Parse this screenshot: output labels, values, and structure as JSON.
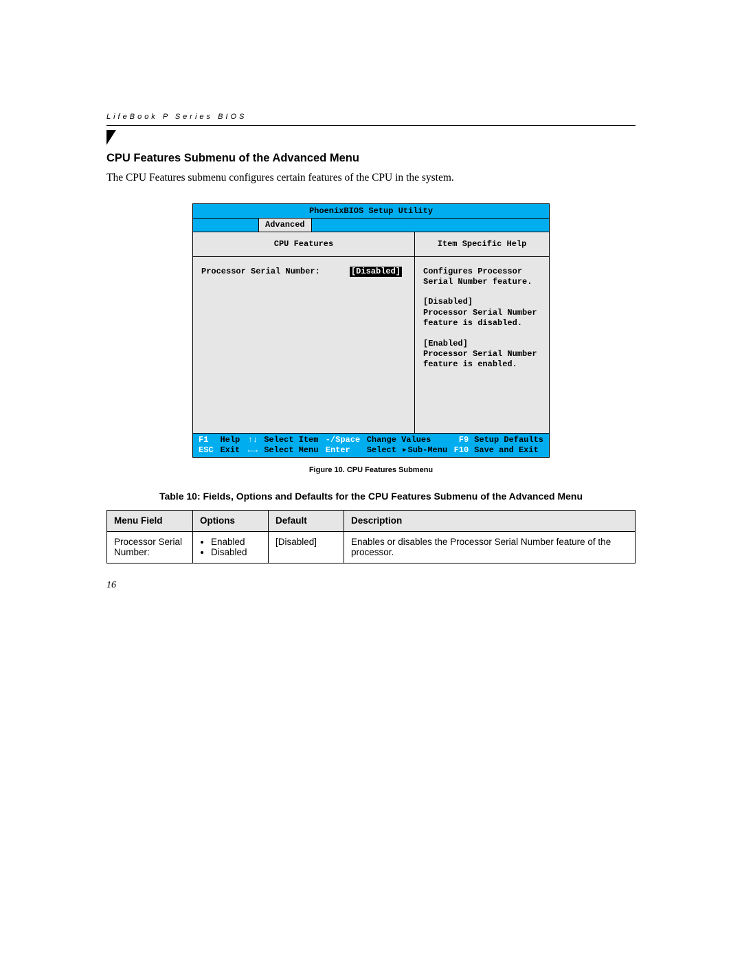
{
  "header": {
    "running": "LifeBook P Series BIOS"
  },
  "section": {
    "title": "CPU Features Submenu of the Advanced Menu",
    "intro": "The CPU Features submenu configures certain features of the CPU in the system."
  },
  "bios": {
    "title": "PhoenixBIOS Setup Utility",
    "menubar": {
      "active": "Advanced"
    },
    "left": {
      "title": "CPU Features",
      "field_label": "Processor Serial Number:",
      "field_value": "[Disabled]"
    },
    "right": {
      "title": "Item Specific Help",
      "p1": "Configures Processor Serial Number feature.",
      "p2a": "[Disabled]",
      "p2b": "Processor Serial Number feature is disabled.",
      "p3a": "[Enabled]",
      "p3b": "Processor Serial Number feature is enabled."
    },
    "footer": {
      "r1c1k": "F1",
      "r1c1d": "Help",
      "r1c2k": "↑↓",
      "r1c2d": "Select Item",
      "r1c3k": "-/Space",
      "r1c3d": "Change Values",
      "r1c4k": "F9",
      "r1c4d": "Setup Defaults",
      "r2c1k": "ESC",
      "r2c1d": "Exit",
      "r2c2k": "←→",
      "r2c2d": "Select Menu",
      "r2c3k": "Enter",
      "r2c3d_pre": "Select",
      "r2c3d_post": "Sub-Menu",
      "r2c4k": "F10",
      "r2c4d": "Save and Exit"
    }
  },
  "figure": {
    "caption": "Figure 10.  CPU Features Submenu"
  },
  "table": {
    "caption": "Table 10: Fields, Options and Defaults for the CPU Features Submenu of the Advanced Menu",
    "headers": {
      "c1": "Menu Field",
      "c2": "Options",
      "c3": "Default",
      "c4": "Description"
    },
    "rows": [
      {
        "menu_field": "Processor Serial Number:",
        "options": [
          "Enabled",
          "Disabled"
        ],
        "default": "[Disabled]",
        "description": "Enables or disables the Processor Serial Number feature of the processor."
      }
    ]
  },
  "page_number": "16"
}
